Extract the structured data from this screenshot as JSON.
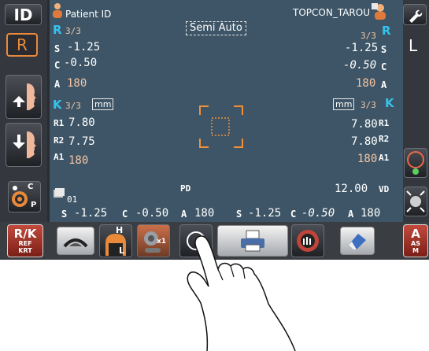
{
  "left_panel": {
    "id_button": "ID",
    "r_button": "R",
    "cp_labels": [
      "C",
      "P"
    ],
    "rk_button": {
      "main": "R/K",
      "sub1": "REF",
      "sub2": "KRT"
    }
  },
  "right_panel": {
    "wrench_icon": "wrench-icon",
    "l_label": "L",
    "a_button": {
      "main": "A",
      "sub1": "AS",
      "sub2": "M"
    }
  },
  "header": {
    "patient_id_label": "Patient ID",
    "operator": "TOPCON_TAROU",
    "mode": "Semi Auto"
  },
  "right_eye": {
    "side": "R",
    "count": "3/3",
    "S": "-1.25",
    "C": "-0.50",
    "A": "180",
    "k_label": "K",
    "k_count": "3/3",
    "k_unit": "mm",
    "R1": "7.80",
    "R2": "7.75",
    "A1": "180"
  },
  "left_eye": {
    "side": "R",
    "count": "3/3",
    "S": "-1.25",
    "C": "-0.50",
    "A": "180",
    "k_label": "K",
    "k_count": "3/3",
    "k_unit": "mm",
    "R1": "7.80",
    "R2": "7.80",
    "A1": "180"
  },
  "labels": {
    "S": "S",
    "C": "C",
    "A": "A",
    "R1": "R1",
    "R2": "R2",
    "A1": "A1",
    "H": "H",
    "L": "L",
    "x1": "x1"
  },
  "pd": {
    "label": "PD",
    "vd": "12.00",
    "vd_label": "VD"
  },
  "footer": {
    "record": "01",
    "s_left": "-1.25",
    "c_left": "-0.50",
    "a_left": "180",
    "s_right": "-1.25",
    "c_right": "-0.50",
    "a_right": "180"
  }
}
